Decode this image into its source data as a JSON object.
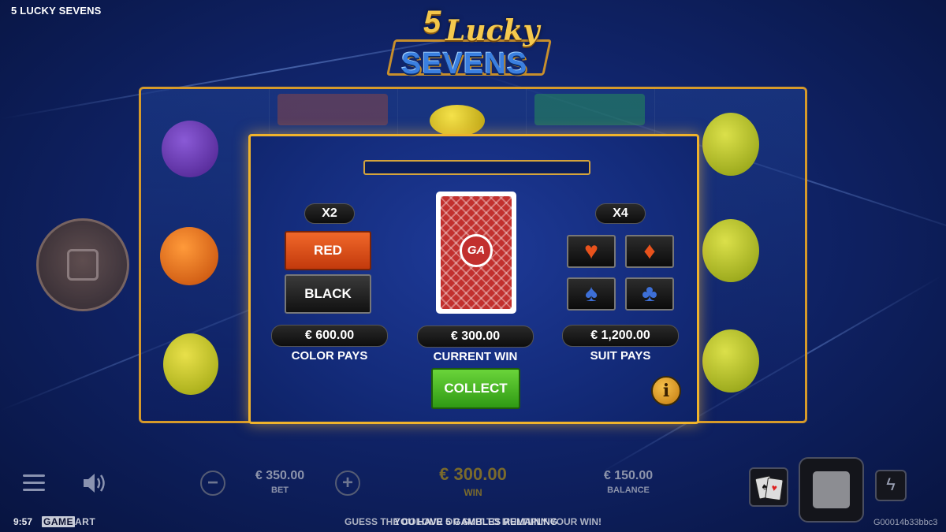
{
  "app": {
    "title": "5 LUCKY SEVENS"
  },
  "logo": {
    "num": "5",
    "lucky": "Lucky",
    "sevens": "SEVENS"
  },
  "gamble": {
    "color_multiplier": "X2",
    "suit_multiplier": "X4",
    "red_label": "RED",
    "black_label": "BLACK",
    "card_brand": "GA",
    "color_pays_value": "€ 600.00",
    "color_pays_label": "COLOR PAYS",
    "current_win_value": "€ 300.00",
    "current_win_label": "CURRENT WIN",
    "suit_pays_value": "€ 1,200.00",
    "suit_pays_label": "SUIT PAYS",
    "collect_label": "COLLECT",
    "info_label": "i",
    "suits": [
      {
        "name": "hearts",
        "glyph": "♥"
      },
      {
        "name": "diamonds",
        "glyph": "♦"
      },
      {
        "name": "spades",
        "glyph": "♠"
      },
      {
        "name": "clubs",
        "glyph": "♣"
      }
    ]
  },
  "hud": {
    "bet_value": "€ 350.00",
    "bet_label": "BET",
    "win_value": "€ 300.00",
    "win_label": "WIN",
    "balance_value": "€ 150.00",
    "balance_label": "BALANCE",
    "minus": "−",
    "plus": "+",
    "turbo_glyph": "ϟ"
  },
  "footer": {
    "clock": "9:57",
    "brand_left": "GAME",
    "brand_right": "ART",
    "ticker_back": "GUESS THE COLOUR OR SUIT TO MULTIPLY YOUR WIN!",
    "ticker_front": "YOU HAVE 5 GAMBLES REMAINING",
    "game_id": "G00014b33bbc3"
  },
  "colors": {
    "accent_gold": "#f0b32c",
    "red_button": "#d9481a",
    "collect_green": "#48b824",
    "background": "#10246a"
  }
}
